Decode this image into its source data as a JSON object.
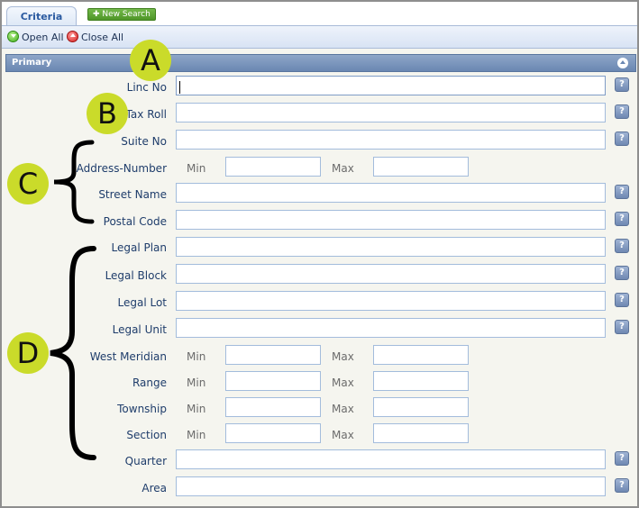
{
  "tabs": {
    "criteria_label": "Criteria",
    "new_search_label": "New Search"
  },
  "toolbar": {
    "open_all_label": "Open All",
    "close_all_label": "Close All"
  },
  "section": {
    "title": "Primary"
  },
  "min_label": "Min",
  "max_label": "Max",
  "help_glyph": "?",
  "fields": {
    "linc_no": "Linc No",
    "tax_roll": "Tax Roll",
    "suite_no": "Suite No",
    "address_number": "Address-Number",
    "street_name": "Street Name",
    "postal_code": "Postal Code",
    "legal_plan": "Legal Plan",
    "legal_block": "Legal Block",
    "legal_lot": "Legal Lot",
    "legal_unit": "Legal Unit",
    "west_meridian": "West Meridian",
    "range": "Range",
    "township": "Township",
    "section": "Section",
    "quarter": "Quarter",
    "area": "Area"
  },
  "annotations": {
    "a": "A",
    "b": "B",
    "c": "C",
    "d": "D"
  },
  "colors": {
    "annotation_marker": "#cadb2a",
    "section_header": "#7a94bc",
    "new_search_button": "#5ea535"
  }
}
